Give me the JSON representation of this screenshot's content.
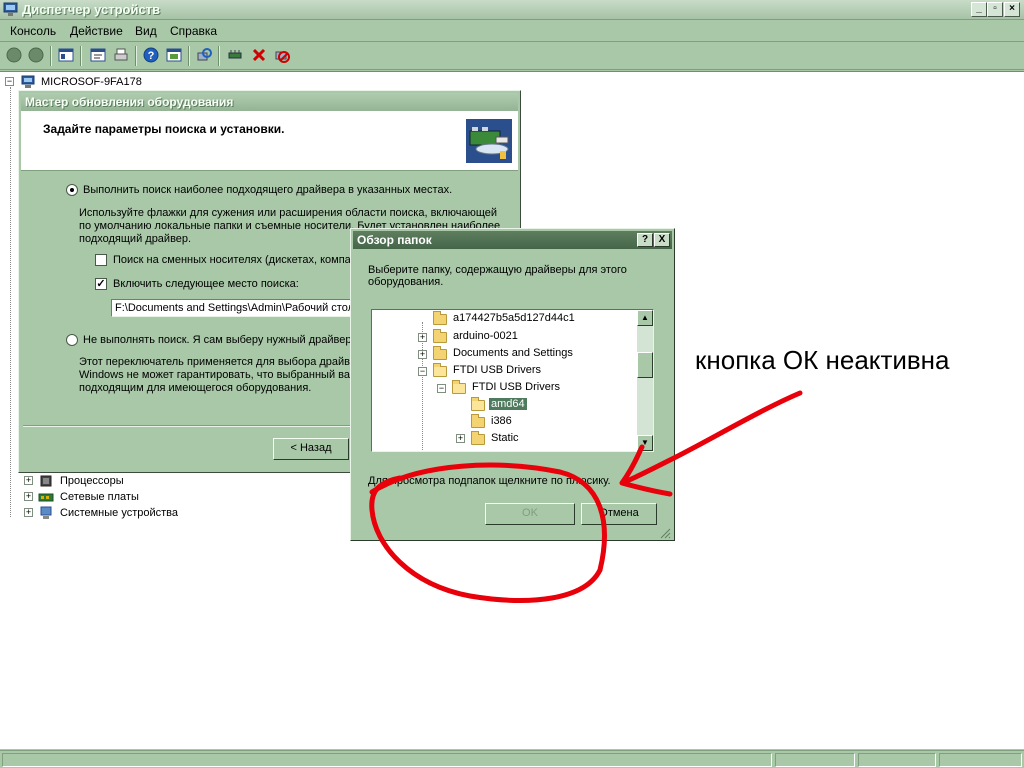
{
  "window": {
    "title": "Диспетчер устройств",
    "controls": {
      "minimize": "_",
      "restore": "▫",
      "close": "×"
    }
  },
  "menu": [
    "Консоль",
    "Действие",
    "Вид",
    "Справка"
  ],
  "tree": {
    "root": "MICROSOF-9FA178",
    "items": [
      "Процессоры",
      "Сетевые платы",
      "Системные устройства"
    ]
  },
  "wizard": {
    "title": "Мастер обновления оборудования",
    "heading": "Задайте параметры поиска и установки.",
    "option1": "Выполнить поиск наиболее подходящего драйвера в указанных местах.",
    "option1_desc": [
      "Используйте флажки для сужения или расширения области поиска, включающей",
      "по умолчанию локальные папки и съемные носители. Будет установлен наиболее",
      "подходящий драйвер."
    ],
    "check_removable": "Поиск на сменных носителях (дискетах, компа",
    "check_location": "Включить следующее место поиска:",
    "path_value": "F:\\Documents and Settings\\Admin\\Рабочий стол",
    "option2": "Не выполнять поиск. Я сам выберу нужный драйвер",
    "option2_desc": [
      "Этот переключатель применяется для выбора драйвер",
      "Windows не может гарантировать, что выбранный ва",
      "подходящим для имеющегося оборудования."
    ],
    "back_button": "< Назад"
  },
  "browse": {
    "title": "Обзор папок",
    "help_btn": "?",
    "close_btn": "X",
    "prompt": [
      "Выберите папку, содержащую драйверы для этого",
      "оборудования."
    ],
    "folders": [
      {
        "name": "a174427b5a5d127d44c1",
        "exp": ""
      },
      {
        "name": "arduino-0021",
        "exp": "+"
      },
      {
        "name": "Documents and Settings",
        "exp": "+"
      },
      {
        "name": "FTDI USB Drivers",
        "exp": "−"
      },
      {
        "name": "FTDI USB Drivers",
        "exp": "−"
      },
      {
        "name": "amd64",
        "exp": ""
      },
      {
        "name": "i386",
        "exp": ""
      },
      {
        "name": "Static",
        "exp": "+"
      }
    ],
    "hint": "Для просмотра подпапок щелкните по плюсику.",
    "ok_button": "OK",
    "cancel_button": "Отмена"
  },
  "annotation": {
    "text": "кнопка ОК неактивна",
    "color": "#e8000a"
  }
}
